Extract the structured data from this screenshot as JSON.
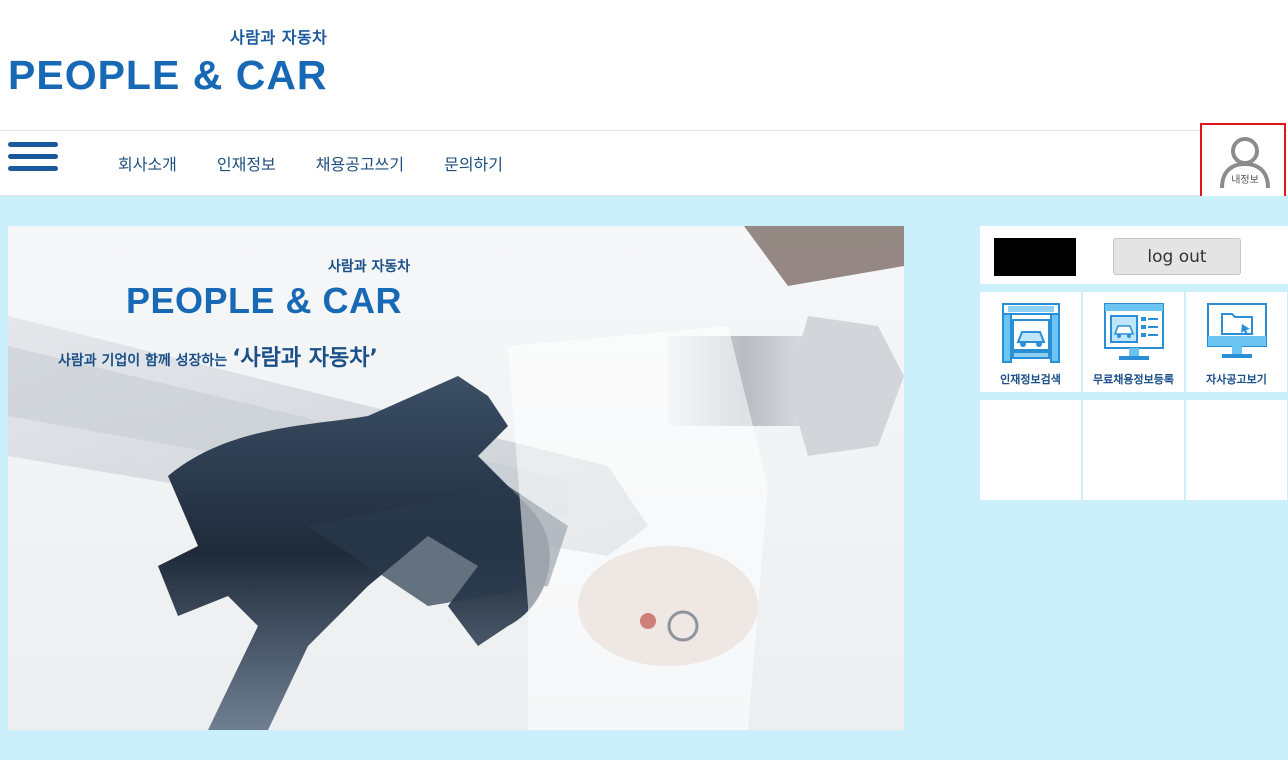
{
  "brand": {
    "tagline_ko": "사람과 자동차",
    "name": "PEOPLE & CAR"
  },
  "nav": {
    "menu": [
      {
        "label": "회사소개"
      },
      {
        "label": "인재정보"
      },
      {
        "label": "채용공고쓰기"
      },
      {
        "label": "문의하기"
      }
    ],
    "myinfo_label": "내정보"
  },
  "banner": {
    "sub": "사람과 자동차",
    "title": "PEOPLE & CAR",
    "tagline_small": "사람과 기업이 함께 성장하는 ",
    "tagline_big": "‘사람과 자동차’"
  },
  "side": {
    "logout_label": "log out",
    "tiles": [
      {
        "label": "인재정보검색",
        "icon": "talent-search-icon"
      },
      {
        "label": "무료채용정보등록",
        "icon": "free-job-register-icon"
      },
      {
        "label": "자사공고보기",
        "icon": "company-post-view-icon"
      }
    ]
  },
  "colors": {
    "brand_blue": "#1768b5",
    "nav_text": "#1e4f7d",
    "main_bg": "#ccf0fb",
    "highlight_red": "#e0141c"
  }
}
